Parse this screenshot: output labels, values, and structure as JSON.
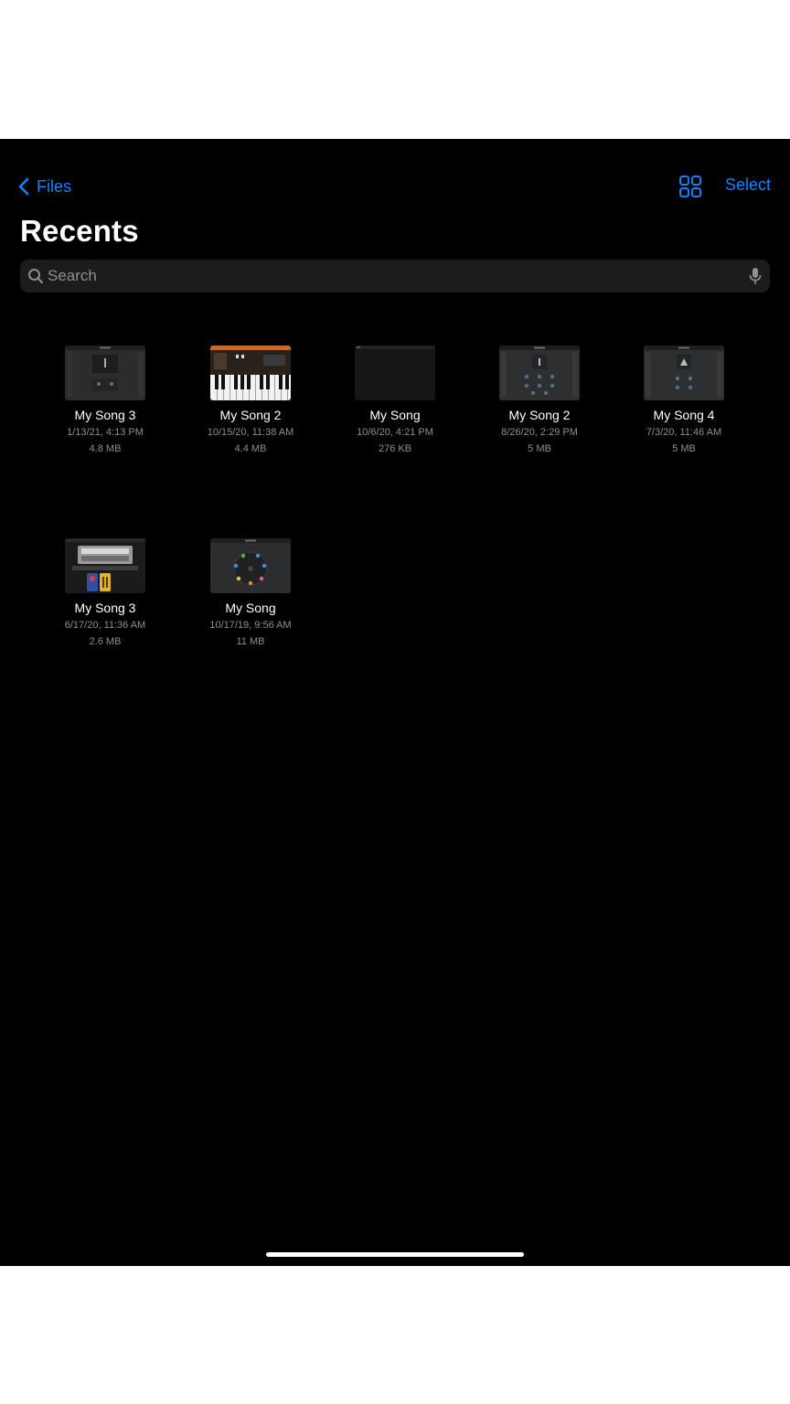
{
  "nav": {
    "back_label": "Files",
    "select_label": "Select"
  },
  "page": {
    "title": "Recents"
  },
  "search": {
    "placeholder": "Search"
  },
  "files": [
    {
      "name": "My Song 3",
      "date": "1/13/21, 4:13 PM",
      "size": "4.8 MB",
      "thumbnail": "live-loops-dark"
    },
    {
      "name": "My Song 2",
      "date": "10/15/20, 11:38 AM",
      "size": "4.4 MB",
      "thumbnail": "keyboard-instrument"
    },
    {
      "name": "My Song",
      "date": "10/6/20, 4:21 PM",
      "size": "276 KB",
      "thumbnail": "empty-dark"
    },
    {
      "name": "My Song 2",
      "date": "8/26/20, 2:29 PM",
      "size": "5 MB",
      "thumbnail": "drum-pads-dark"
    },
    {
      "name": "My Song 4",
      "date": "7/3/20, 11:46 AM",
      "size": "5 MB",
      "thumbnail": "drum-pads-dark"
    },
    {
      "name": "My Song 3",
      "date": "6/17/20, 11:36 AM",
      "size": "2.6 MB",
      "thumbnail": "amp-pedals"
    },
    {
      "name": "My Song",
      "date": "10/17/19, 9:56 AM",
      "size": "11 MB",
      "thumbnail": "beat-sequencer-circle"
    }
  ],
  "colors": {
    "accent": "#0a84ff",
    "background": "#000000",
    "search_background": "#1c1c1e",
    "secondary_text": "#8e8e93"
  }
}
